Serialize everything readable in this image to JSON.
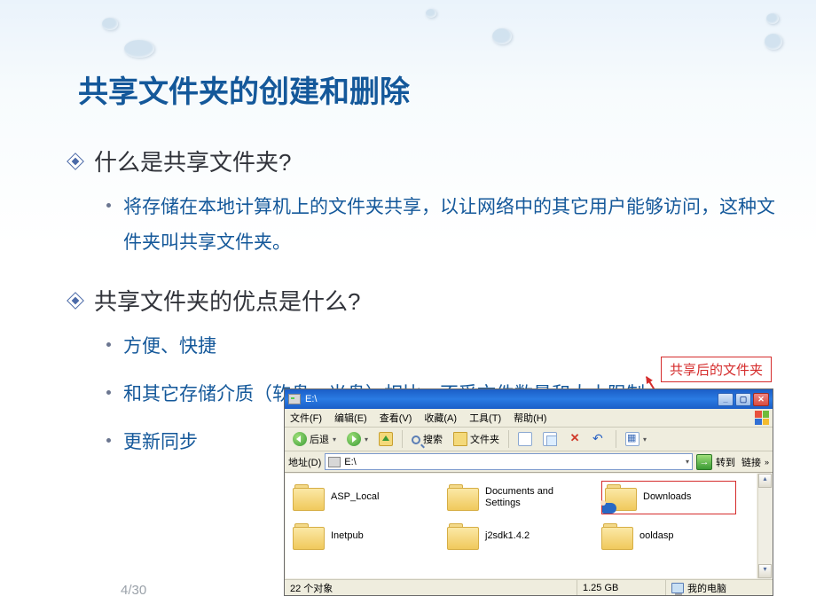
{
  "page": {
    "title": "共享文件夹的创建和删除",
    "current": "4",
    "total": "30"
  },
  "bullets": {
    "q1": "什么是共享文件夹?",
    "q1a": "将存储在本地计算机上的文件夹共享，以让网络中的其它用户能够访问，这种文件夹叫共享文件夹。",
    "q2": "共享文件夹的优点是什么?",
    "q2a": "方便、快捷",
    "q2b": "和其它存储介质（软盘、光盘）相比，不受文件数量和大小限制",
    "q2c": "更新同步"
  },
  "annotation": {
    "label": "共享后的文件夹"
  },
  "explorer": {
    "title": "E:\\",
    "menu": {
      "file": "文件(F)",
      "edit": "编辑(E)",
      "view": "查看(V)",
      "fav": "收藏(A)",
      "tools": "工具(T)",
      "help": "帮助(H)"
    },
    "toolbar": {
      "back": "后退",
      "search": "搜索",
      "folders": "文件夹"
    },
    "address": {
      "label": "地址(D)",
      "value": "E:\\",
      "go": "转到",
      "links": "链接"
    },
    "items": {
      "f1": "ASP_Local",
      "f2": "Documents and Settings",
      "f3": "Downloads",
      "f4": "Inetpub",
      "f5": "j2sdk1.4.2",
      "f6": "ooldasp"
    },
    "status": {
      "objects": "22 个对象",
      "size": "1.25 GB",
      "location": "我的电脑"
    }
  }
}
